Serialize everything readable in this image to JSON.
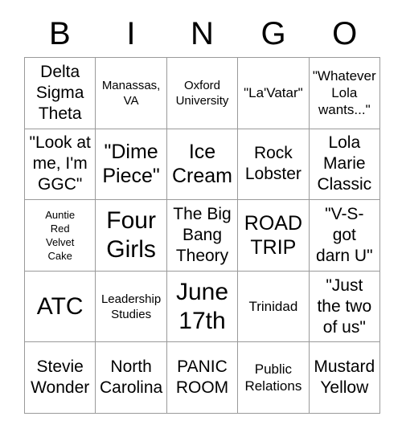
{
  "header": {
    "letters": [
      "B",
      "I",
      "N",
      "G",
      "O"
    ]
  },
  "grid": {
    "rows": [
      [
        {
          "text": "Delta\nSigma\nTheta",
          "size": "fs-l"
        },
        {
          "text": "Manassas,\nVA",
          "size": "fs-s"
        },
        {
          "text": "Oxford\nUniversity",
          "size": "fs-s"
        },
        {
          "text": "\"La'Vatar\"",
          "size": "fs-m"
        },
        {
          "text": "\"Whatever\nLola\nwants...\"",
          "size": "fs-m"
        }
      ],
      [
        {
          "text": "\"Look at\nme, I'm\nGGC\"",
          "size": "fs-l"
        },
        {
          "text": "\"Dime\nPiece\"",
          "size": "fs-xl"
        },
        {
          "text": "Ice\nCream",
          "size": "fs-xl"
        },
        {
          "text": "Rock\nLobster",
          "size": "fs-l"
        },
        {
          "text": "Lola\nMarie\nClassic",
          "size": "fs-l"
        }
      ],
      [
        {
          "text": "Auntie\nRed\nVelvet\nCake",
          "size": "fs-xs"
        },
        {
          "text": "Four\nGirls",
          "size": "fs-xxl"
        },
        {
          "text": "The Big\nBang\nTheory",
          "size": "fs-l"
        },
        {
          "text": "ROAD\nTRIP",
          "size": "fs-xl"
        },
        {
          "text": "\"V-S-\ngot\ndarn U\"",
          "size": "fs-l"
        }
      ],
      [
        {
          "text": "ATC",
          "size": "fs-xxl"
        },
        {
          "text": "Leadership\nStudies",
          "size": "fs-s"
        },
        {
          "text": "June\n17th",
          "size": "fs-xxl"
        },
        {
          "text": "Trinidad",
          "size": "fs-m"
        },
        {
          "text": "\"Just\nthe two\nof us\"",
          "size": "fs-l"
        }
      ],
      [
        {
          "text": "Stevie\nWonder",
          "size": "fs-l"
        },
        {
          "text": "North\nCarolina",
          "size": "fs-l"
        },
        {
          "text": "PANIC\nROOM",
          "size": "fs-l"
        },
        {
          "text": "Public\nRelations",
          "size": "fs-m"
        },
        {
          "text": "Mustard\nYellow",
          "size": "fs-l"
        }
      ]
    ]
  },
  "colors": {
    "border": "#9a9a9a",
    "text": "#000000",
    "background": "#ffffff"
  }
}
